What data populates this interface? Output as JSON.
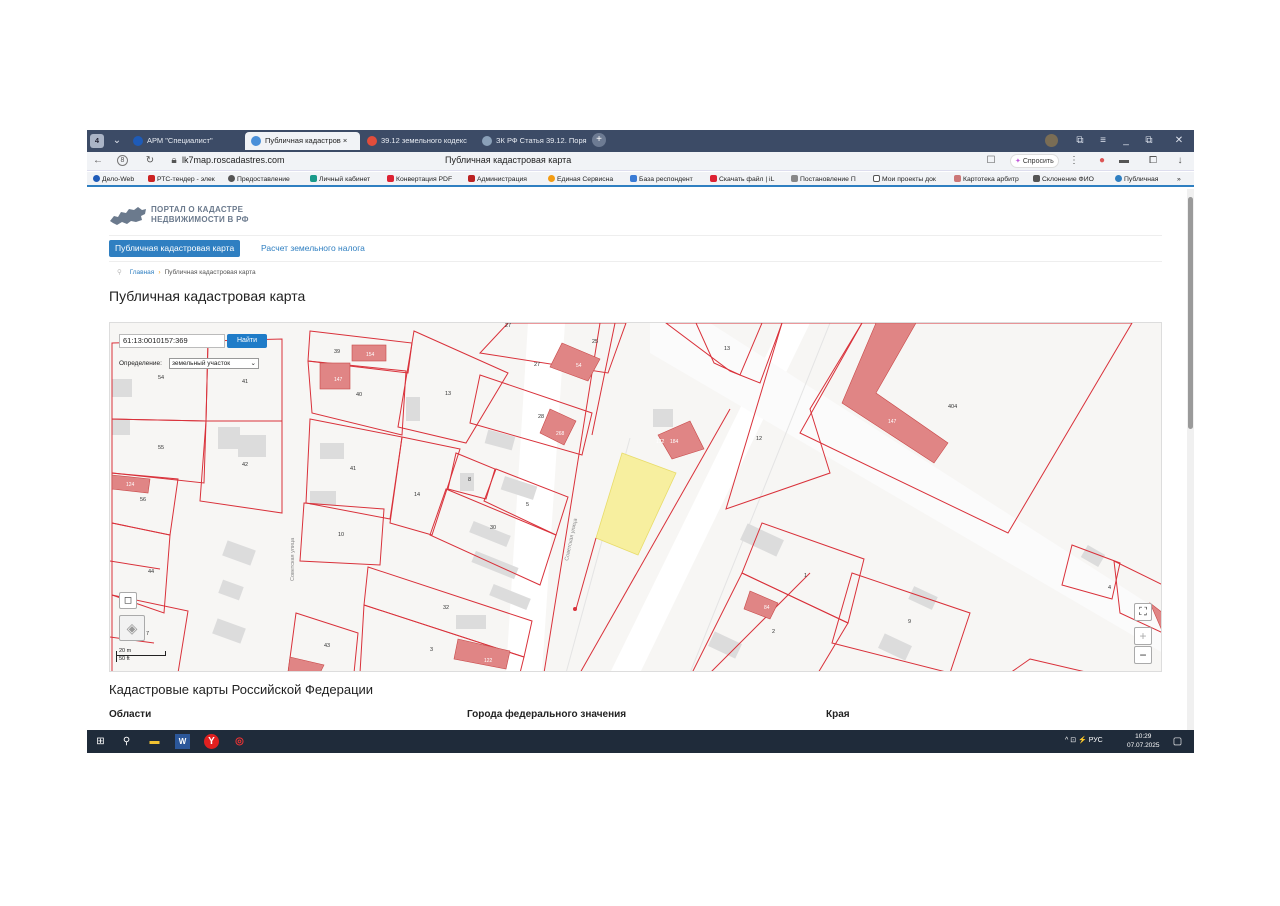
{
  "browser": {
    "tabs": [
      {
        "label": "АРМ \"Специалист\"",
        "active": false
      },
      {
        "label": "Публичная кадастров ×",
        "active": true
      },
      {
        "label": "39.12 земельного кодекс",
        "active": false
      },
      {
        "label": "ЗК РФ Статья 39.12. Поря",
        "active": false
      }
    ],
    "tab_count": "4",
    "url": "lk7map.roscadastres.com",
    "page_title": "Публичная кадастровая карта",
    "ask_label": "Спросить",
    "bookmarks": [
      "Дело-Web",
      "РТС-тендер - элек",
      "Предоставление",
      "Личный кабинет",
      "Конвертация PDF",
      "Администрация",
      "Единая Сервисна",
      "База респондент",
      "Скачать файл | iL",
      "Постановление П",
      "Мои проекты док",
      "Картотека арбитр",
      "Склонение ФИО",
      "Публичная"
    ]
  },
  "portal": {
    "logo_line1": "ПОРТАЛ О КАДАСТРЕ",
    "logo_line2": "НЕДВИЖИМОСТИ В РФ",
    "nav_active": "Публичная кадастровая карта",
    "nav_other": "Расчет земельного налога",
    "breadcrumb_home": "Главная",
    "breadcrumb_current": "Публичная кадастровая карта",
    "heading": "Публичная кадастровая карта"
  },
  "map": {
    "search_value": "61:13:0010157:369",
    "search_button": "Найти",
    "definition_label": "Определение:",
    "definition_value": "земельный участок",
    "scale_line1": "20 m",
    "scale_line2": "50 ft",
    "street_labels": [
      "Советская улица",
      "Советская улица"
    ],
    "parcel_labels": [
      "54",
      "41",
      "55",
      "42",
      "56",
      "44",
      "7",
      "39",
      "40",
      "13",
      "41",
      "14",
      "10",
      "8",
      "5",
      "30",
      "32",
      "3",
      "43",
      "27",
      "25",
      "28",
      "13",
      "12",
      "404",
      "1",
      "2",
      "9",
      "4",
      "27"
    ],
    "building_labels": [
      "154",
      "147",
      "54",
      "268",
      "172",
      "184",
      "147",
      "124",
      "122",
      "84"
    ],
    "colors": {
      "parcel_line": "#d9313a",
      "building_fill": "#e08585",
      "selected_fill": "#f7ef9f",
      "road_fill": "#ffffff"
    }
  },
  "footer": {
    "heading": "Кадастровые карты Российской Федерации",
    "columns": [
      "Области",
      "Города федерального значения",
      "Края"
    ]
  },
  "taskbar": {
    "lang": "РУС",
    "time": "10:29",
    "date": "07.07.2025"
  }
}
